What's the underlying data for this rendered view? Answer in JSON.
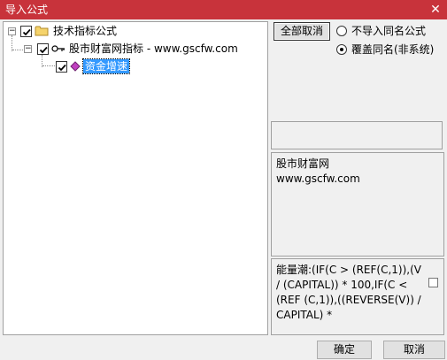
{
  "window": {
    "title": "导入公式",
    "close_glyph": "✕"
  },
  "tree": {
    "root": {
      "label": "技术指标公式",
      "checked": true,
      "expander": "−",
      "icon": "folder-icon"
    },
    "child": {
      "label": "股市财富网指标 - www.gscfw.com",
      "checked": true,
      "expander": "−",
      "icon": "key-icon"
    },
    "leaf": {
      "label": "资金增速",
      "checked": true,
      "selected": true,
      "icon": "diamond-icon"
    }
  },
  "actions": {
    "cancel_all_label": "全部取消"
  },
  "options": [
    {
      "label": "不导入同名公式",
      "selected": false
    },
    {
      "label": "覆盖同名(非系统)",
      "selected": true
    }
  ],
  "info": {
    "line1": "股市财富网",
    "line2": "www.gscfw.com"
  },
  "formula": {
    "text": "能量潮:(IF(C > (REF(C,1)),(V / (CAPITAL)) * 100,IF(C < (REF (C,1)),((REVERSE(V)) / CAPITAL) *"
  },
  "footer": {
    "ok_label": "确定",
    "cancel_label": "取消"
  },
  "colors": {
    "titlebar": "#c8333b",
    "selection": "#3399ff",
    "folder": "#f5d36b",
    "diamond": "#c040c0"
  }
}
